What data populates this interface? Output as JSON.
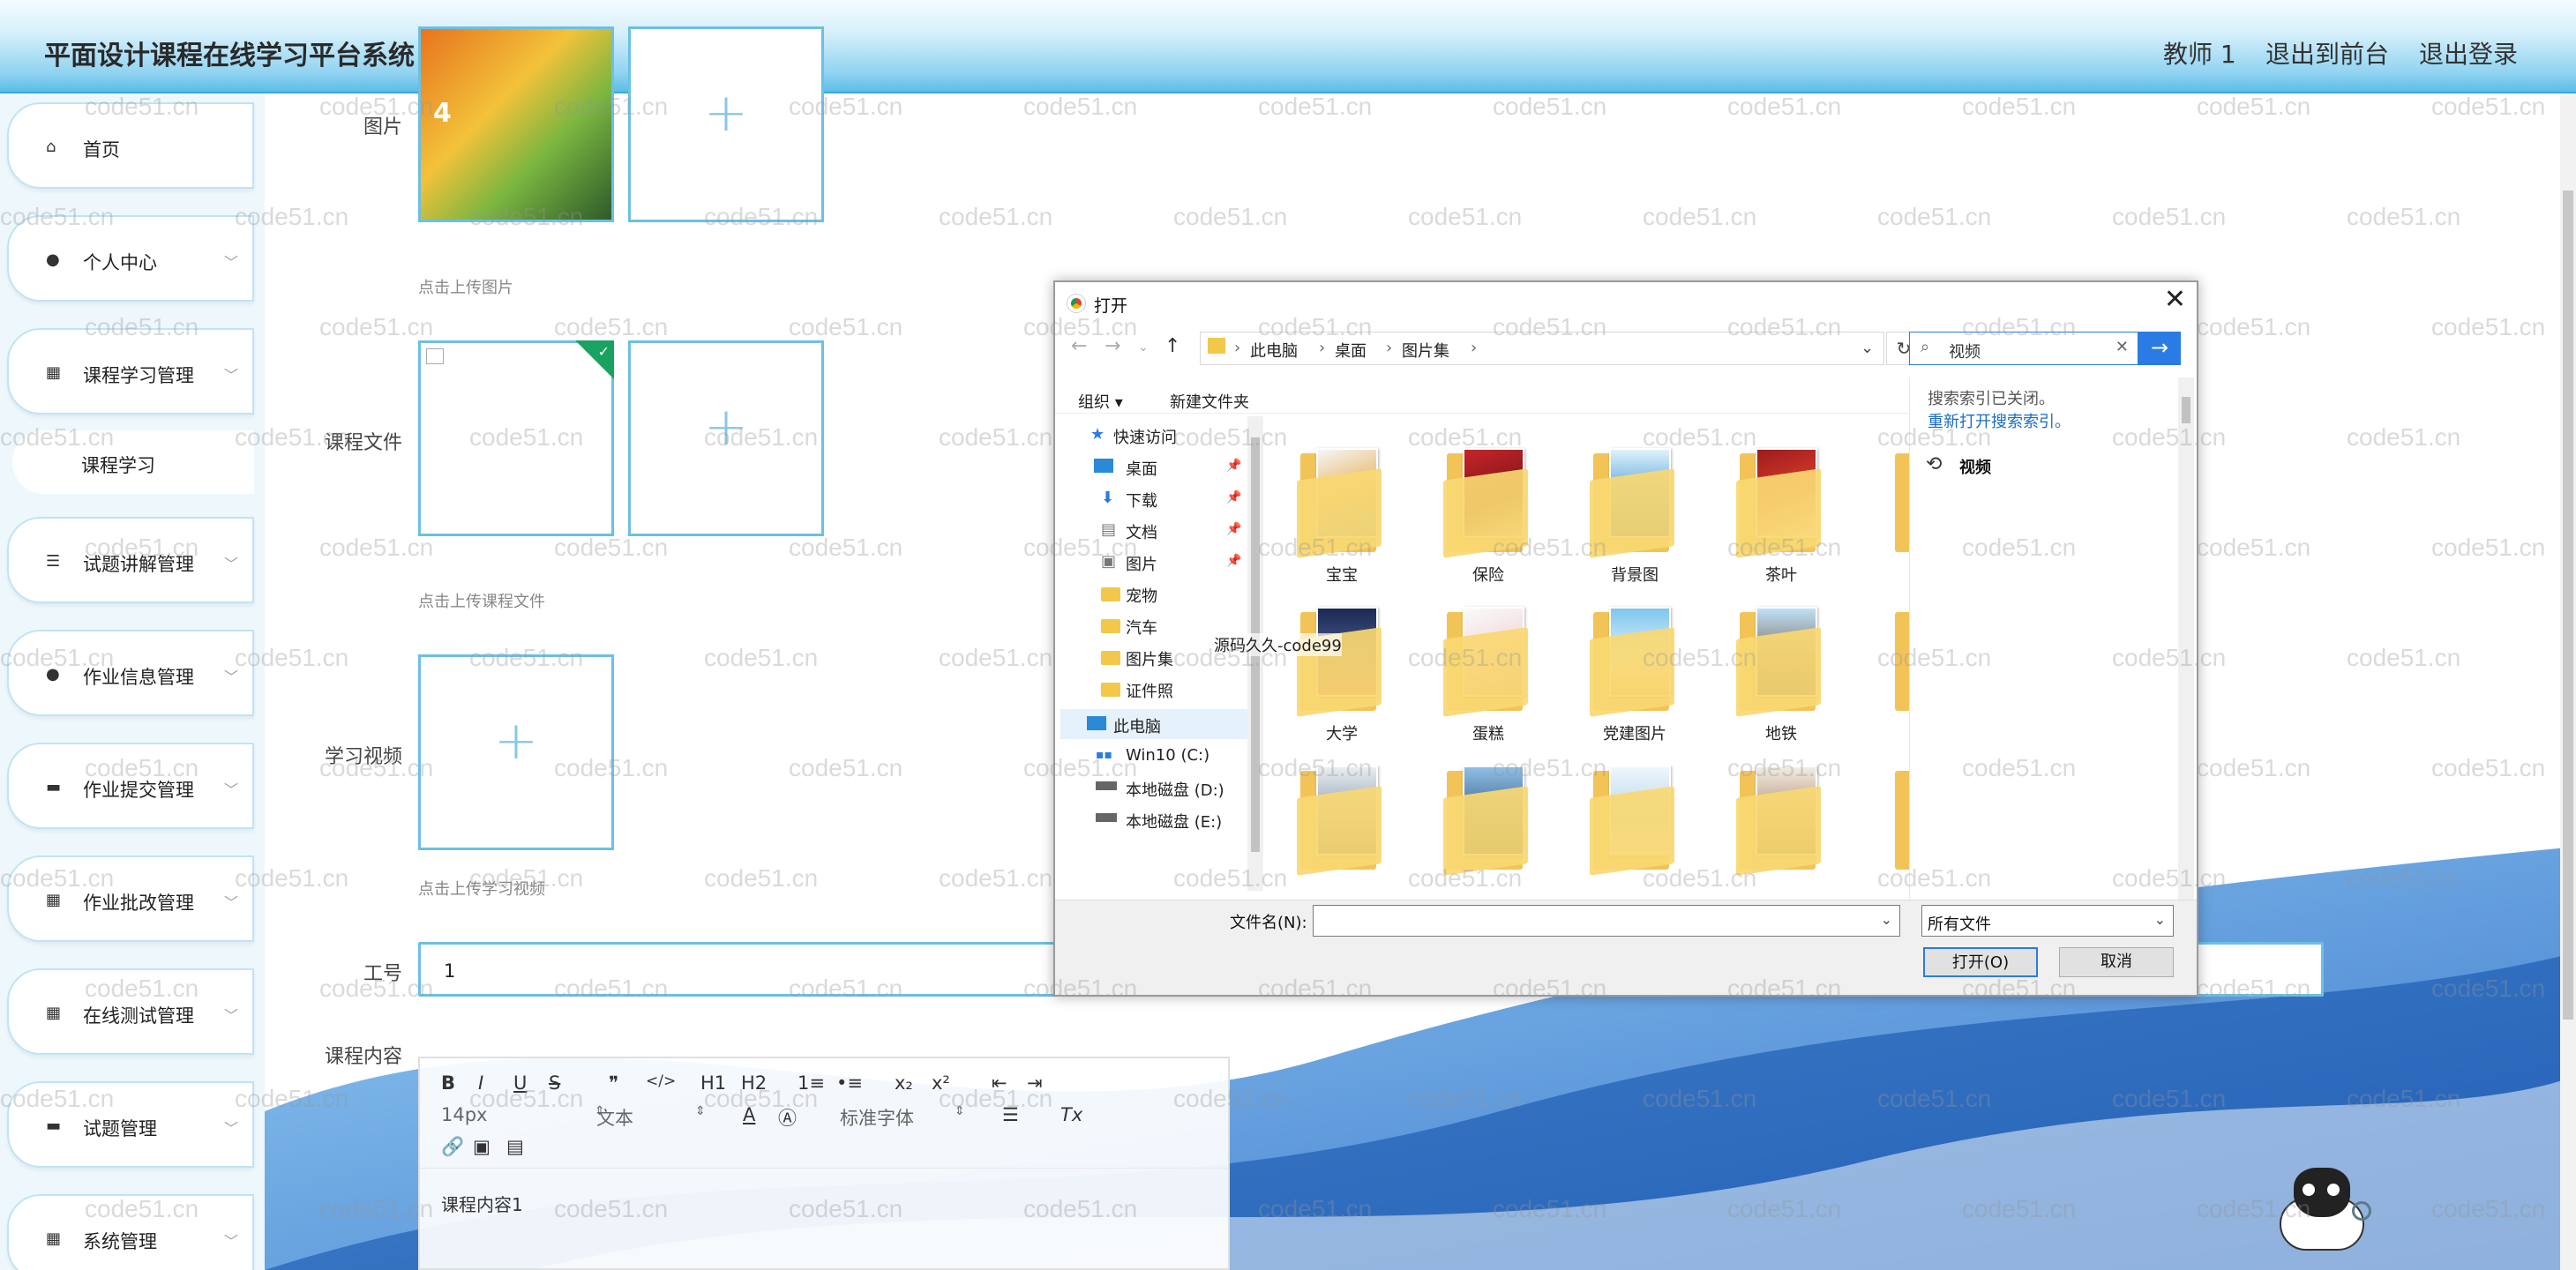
{
  "app": {
    "title": "平面设计课程在线学习平台系统"
  },
  "topnav": {
    "user": "教师 1",
    "front": "退出到前台",
    "logout": "退出登录"
  },
  "sidebar": {
    "items": [
      {
        "label": "首页",
        "icon": "home-icon"
      },
      {
        "label": "个人中心",
        "icon": "user-icon"
      },
      {
        "label": "课程学习管理",
        "icon": "grid-icon"
      },
      {
        "label": "课程学习",
        "icon": ""
      },
      {
        "label": "试题讲解管理",
        "icon": "list-icon"
      },
      {
        "label": "作业信息管理",
        "icon": "user-icon"
      },
      {
        "label": "作业提交管理",
        "icon": "monitor-icon"
      },
      {
        "label": "作业批改管理",
        "icon": "grid-icon"
      },
      {
        "label": "在线测试管理",
        "icon": "grid-icon"
      },
      {
        "label": "试题管理",
        "icon": "monitor-icon"
      },
      {
        "label": "系统管理",
        "icon": "grid-icon"
      }
    ]
  },
  "form": {
    "image_label": "图片",
    "image_hint": "点击上传图片",
    "file_label": "课程文件",
    "file_hint": "点击上传课程文件",
    "video_label": "学习视频",
    "video_hint": "点击上传学习视频",
    "jobno_label": "工号",
    "jobno_value": "1",
    "content_label": "课程内容",
    "content_value": "课程内容1"
  },
  "editor": {
    "font_size": "14px",
    "text_type": "文本",
    "font_family": "标准字体",
    "buttons": [
      "B",
      "I",
      "U",
      "S",
      "❞",
      "</>",
      "H1",
      "H2",
      "1≡",
      "•≡",
      "x₂",
      "x²",
      "⇤",
      "⇥"
    ]
  },
  "dialog": {
    "title": "打开",
    "breadcrumb": [
      "此电脑",
      "桌面",
      "图片集"
    ],
    "search_value": "视频",
    "organize": "组织 ▾",
    "new_folder": "新建文件夹",
    "tree": [
      "快速访问",
      "桌面",
      "下载",
      "文档",
      "图片",
      "宠物",
      "汽车",
      "图片集",
      "证件照",
      "此电脑",
      "Win10 (C:)",
      "本地磁盘 (D:)",
      "本地磁盘 (E:)"
    ],
    "files_row1": [
      "宝宝",
      "保险",
      "背景图",
      "茶叶"
    ],
    "files_row2": [
      "大学",
      "蛋糕",
      "党建图片",
      "地铁"
    ],
    "search_notice": "搜索索引已关闭。",
    "search_link": "重新打开搜索索引。",
    "recent": "视频",
    "filename_label": "文件名(N):",
    "filetype": "所有文件",
    "open_btn": "打开(O)",
    "cancel_btn": "取消",
    "overlay_text": "源码久久-code99"
  },
  "watermark": "code51.cn",
  "colors": {
    "accent": "#38a8dc",
    "border": "#6cc0e3",
    "dialog_blue": "#2a7be4"
  }
}
